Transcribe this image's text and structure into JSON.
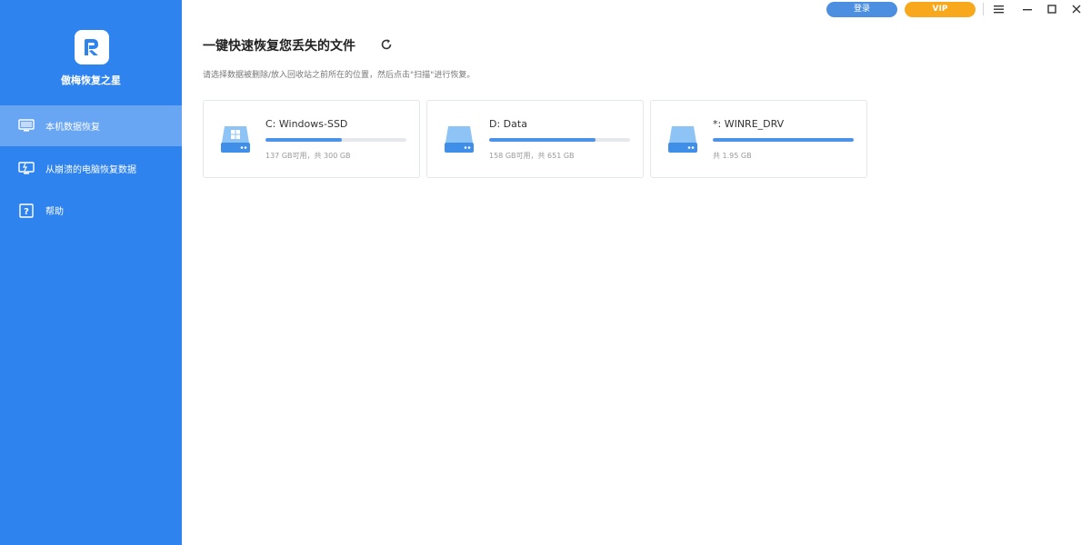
{
  "app": {
    "name": "傲梅恢复之星",
    "accent_color": "#2f83ee"
  },
  "topbar": {
    "login_label": "登录",
    "vip_label": "VIP",
    "menu_icon": "menu-icon",
    "minimize_icon": "minimize-icon",
    "maximize_icon": "maximize-icon",
    "close_icon": "close-icon"
  },
  "sidebar": {
    "items": [
      {
        "label": "本机数据恢复",
        "icon": "monitor-icon",
        "active": true
      },
      {
        "label": "从崩溃的电脑恢复数据",
        "icon": "crashed-pc-icon",
        "active": false
      },
      {
        "label": "帮助",
        "icon": "help-icon",
        "active": false
      }
    ]
  },
  "main": {
    "title": "一键快速恢复您丢失的文件",
    "subtitle": "请选择数据被删除/放入回收站之前所在的位置，然后点击\"扫描\"进行恢复。",
    "drives": [
      {
        "name": "C: Windows-SSD",
        "info": "137 GB可用，共 300 GB",
        "used_fraction": 0.543,
        "system": true
      },
      {
        "name": "D: Data",
        "info": "158 GB可用，共 651 GB",
        "used_fraction": 0.757,
        "system": false
      },
      {
        "name": "*: WINRE_DRV",
        "info": "共 1.95 GB",
        "used_fraction": 1.0,
        "system": false
      }
    ]
  }
}
